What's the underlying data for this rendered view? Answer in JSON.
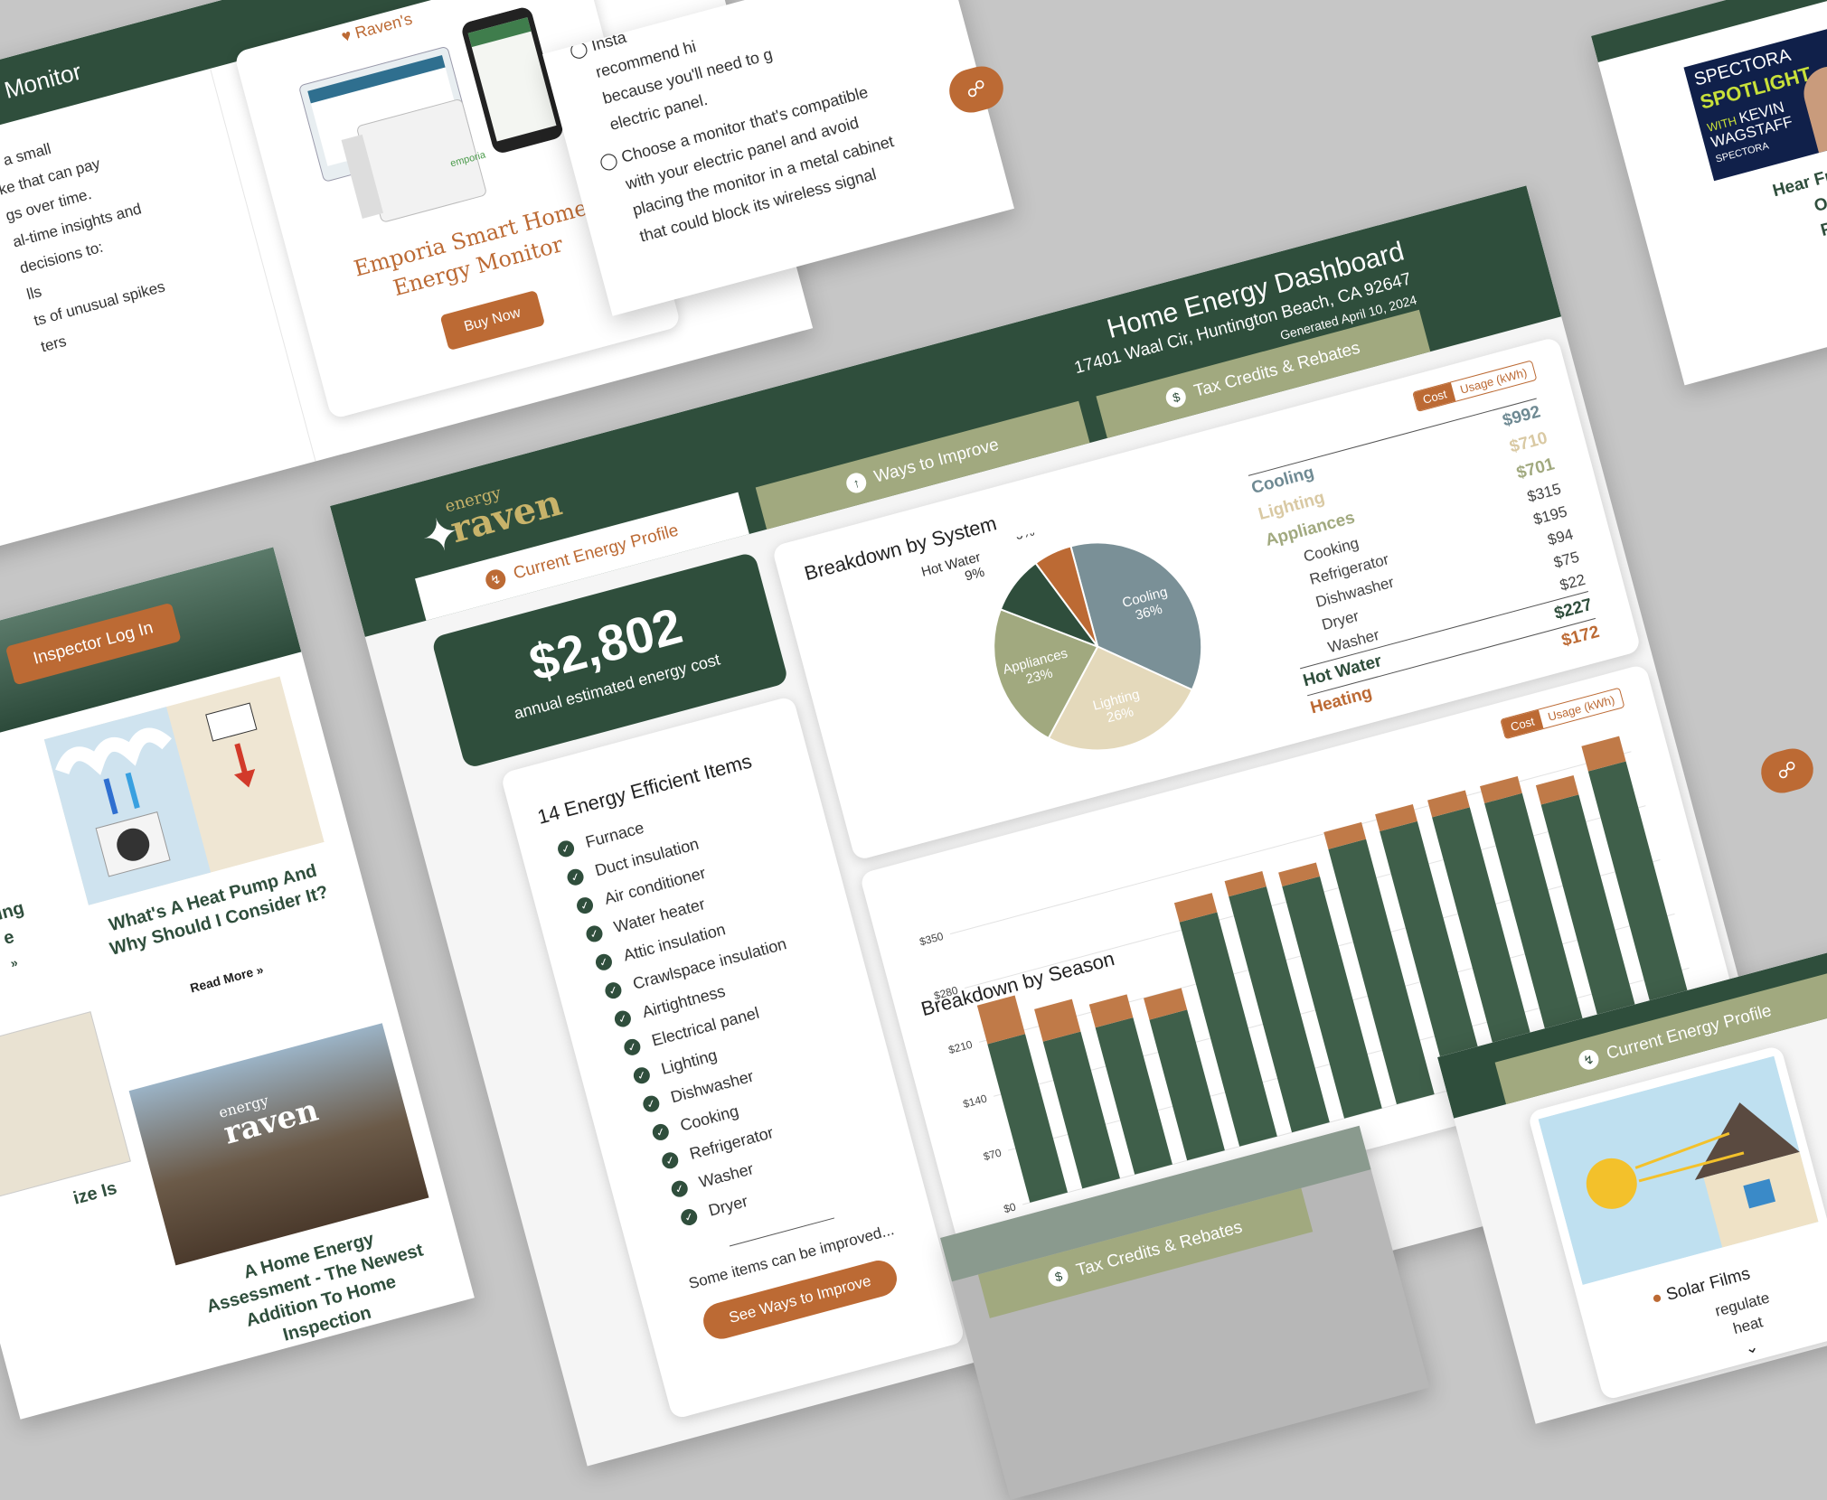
{
  "tl_tile": {
    "heading": "gy Monitor",
    "lines": [
      "s a small",
      "ke that can pay",
      "gs over time.",
      "al-time insights and",
      "decisions to:",
      "lls",
      "ts of unusual spikes",
      "ters"
    ],
    "product_tag": "Raven's",
    "product_name": "Emporia Smart Home Energy Monitor",
    "buy_label": "Buy Now"
  },
  "tm_tile": {
    "lines": [
      "Insta",
      "recommend hi",
      "because you'll need to g",
      "electric panel."
    ],
    "tip_lines": [
      "Choose a monitor that's compatible",
      "with your electric panel and avoid",
      "placing the monitor in a metal cabinet",
      "that could block its wireless signal"
    ]
  },
  "tr_tile": {
    "spot_line1": "SPECTORA",
    "spot_line2": "SPOTLIGHT",
    "spot_with": "WITH",
    "spot_name1": "KEVIN",
    "spot_name2": "WAGSTAFF",
    "spot_brand": "SPECTORA",
    "caption_lines": [
      "Hear Fro",
      "On",
      "Pod"
    ]
  },
  "dashboard": {
    "title": "Home Energy Dashboard",
    "address": "17401 Waal Cir, Huntington Beach, CA 92647",
    "generated": "Generated April 10, 2024",
    "logo_top": "energy",
    "logo_bottom": "raven",
    "tabs": [
      {
        "label": "Current Energy Profile"
      },
      {
        "label": "Ways to Improve"
      },
      {
        "label": "Tax Credits & Rebates"
      }
    ],
    "cost_total": "$2,802",
    "cost_caption": "annual estimated energy cost",
    "efficient_title": "14 Energy Efficient Items",
    "efficient_items": [
      "Furnace",
      "Duct insulation",
      "Air conditioner",
      "Water heater",
      "Attic insulation",
      "Crawlspace insulation",
      "Airtightness",
      "Electrical panel",
      "Lighting",
      "Dishwasher",
      "Cooking",
      "Refrigerator",
      "Washer",
      "Dryer"
    ],
    "improve_note": "Some items can be improved...",
    "improve_button": "See Ways to Improve",
    "system_title": "Breakdown by System",
    "season_title": "Breakdown by Season",
    "toggle_cost": "Cost",
    "toggle_usage": "Usage (kWh)",
    "system_rows": [
      {
        "name": "Cooling",
        "value": "$992",
        "color": "#6f8a93",
        "level": 0
      },
      {
        "name": "Lighting",
        "value": "$710",
        "color": "#d9c9a3",
        "level": 0
      },
      {
        "name": "Appliances",
        "value": "$701",
        "color": "#a1a97f",
        "level": 0
      },
      {
        "name": "Cooking",
        "value": "$315",
        "color": "#444444",
        "level": 1
      },
      {
        "name": "Refrigerator",
        "value": "$195",
        "color": "#444444",
        "level": 1
      },
      {
        "name": "Dishwasher",
        "value": "$94",
        "color": "#444444",
        "level": 1
      },
      {
        "name": "Dryer",
        "value": "$75",
        "color": "#444444",
        "level": 1
      },
      {
        "name": "Washer",
        "value": "$22",
        "color": "#444444",
        "level": 1
      },
      {
        "name": "Hot Water",
        "value": "$227",
        "color": "#2f4e3c",
        "level": 0
      },
      {
        "name": "Heating",
        "value": "$172",
        "color": "#bc6a34",
        "level": 0
      }
    ]
  },
  "chart_data": [
    {
      "type": "pie",
      "title": "Breakdown by System",
      "slices": [
        {
          "label": "Cooling",
          "value": 36,
          "color": "#7a9097"
        },
        {
          "label": "Lighting",
          "value": 26,
          "color": "#e4d9bb"
        },
        {
          "label": "Appliances",
          "value": 23,
          "color": "#a1a97f"
        },
        {
          "label": "Hot Water",
          "value": 9,
          "color": "#2f4e3c"
        },
        {
          "label": "Heating",
          "value": 6,
          "color": "#bc6a34"
        }
      ],
      "unit": "%"
    },
    {
      "type": "bar",
      "title": "Breakdown by Season",
      "stacked": true,
      "y_ticks": [
        "$0",
        "$70",
        "$140",
        "$210",
        "$280",
        "$350"
      ],
      "ylim": [
        0,
        350
      ],
      "grid": true,
      "series": [
        {
          "values": [
            205,
            190,
            190,
            182,
            290,
            305,
            300,
            330,
            335,
            335,
            335,
            315,
            340
          ],
          "color": "#3f5f4a"
        },
        {
          "values": [
            50,
            42,
            30,
            28,
            25,
            20,
            18,
            22,
            22,
            22,
            22,
            25,
            38
          ],
          "color": "#c07a48"
        }
      ]
    }
  ],
  "left_tile": {
    "login_label": "Inspector Log In",
    "article1_title": "What's A Heat Pump And Why Should I Consider It?",
    "article1_more": "Read More »",
    "article2_title": "A Home Energy Assessment - The Newest Addition To Home Inspection",
    "article2_logo_top": "energy",
    "article2_logo_bottom": "raven",
    "fragments": [
      "ing",
      "e",
      "»",
      "ize Is"
    ]
  },
  "bottom_tile": {
    "tab_label": "Tax Credits & Rebates"
  },
  "br_tile": {
    "tab_label": "Current Energy Profile",
    "solar_title": "Solar Films",
    "solar_lines": [
      "regulate",
      "heat"
    ]
  },
  "fabs": {
    "chat_icon": "chat-icon"
  }
}
